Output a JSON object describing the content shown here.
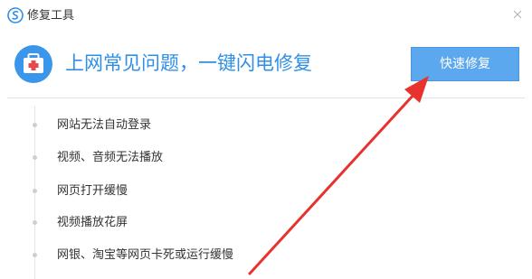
{
  "window": {
    "title": "修复工具",
    "logo_icon": "browser-logo-icon",
    "close_icon": "close-icon"
  },
  "header": {
    "icon": "first-aid-kit-icon",
    "headline": "上网常见问题，一键闪电修复",
    "fix_button_label": "快速修复"
  },
  "issues": [
    {
      "label": "网站无法自动登录"
    },
    {
      "label": "视频、音频无法播放"
    },
    {
      "label": "网页打开缓慢"
    },
    {
      "label": "视频播放花屏"
    },
    {
      "label": "网银、淘宝等网页卡死或运行缓慢"
    }
  ],
  "annotation": {
    "arrow_icon": "red-arrow-icon",
    "arrow_color": "#e8322d"
  },
  "colors": {
    "accent": "#2f8fe6",
    "button": "#5ca8ee",
    "kit_red": "#e54b4b"
  }
}
